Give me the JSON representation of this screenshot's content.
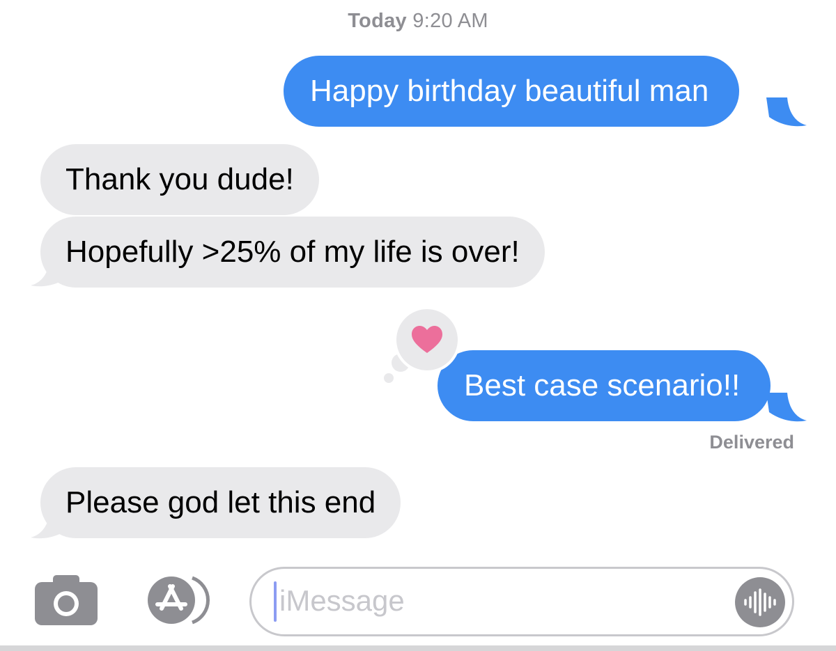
{
  "header": {
    "timestamp_day": "Today",
    "timestamp_time": "9:20 AM"
  },
  "messages": [
    {
      "direction": "outgoing",
      "text": "Happy birthday beautiful man"
    },
    {
      "direction": "incoming",
      "text": "Thank you dude!"
    },
    {
      "direction": "incoming",
      "text": "Hopefully >25% of my life is over!"
    },
    {
      "direction": "outgoing",
      "text": "Best case scenario!!",
      "reaction": "heart-icon"
    },
    {
      "direction": "incoming",
      "text": "Please god let this end"
    }
  ],
  "status": {
    "delivered": "Delivered"
  },
  "input": {
    "placeholder": "iMessage"
  },
  "colors": {
    "outgoing_bubble": "#3d8cf2",
    "incoming_bubble": "#e9e9eb",
    "heart": "#ec6f9b",
    "secondary_text": "#8e8e93"
  },
  "icons": {
    "camera": "camera-icon",
    "apps": "app-store-icon",
    "audio": "audio-waveform-icon",
    "reaction": "heart-icon"
  }
}
